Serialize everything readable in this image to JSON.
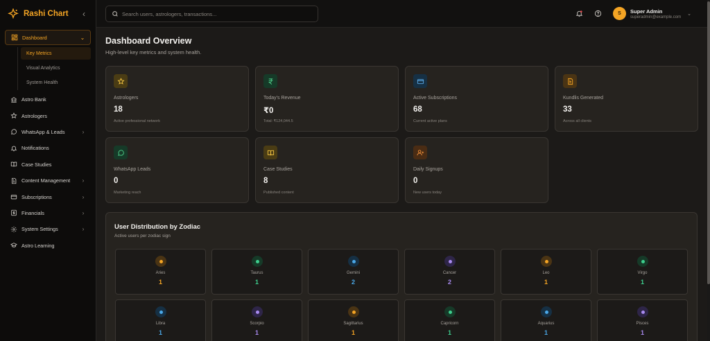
{
  "brand": {
    "name": "Rashi Chart"
  },
  "sidebar": {
    "dashboard": {
      "label": "Dashboard",
      "sub": [
        "Key Metrics",
        "Visual Analytics",
        "System Health"
      ]
    },
    "items": [
      {
        "label": "Astro Bank",
        "icon": "bank-icon",
        "chevron": false
      },
      {
        "label": "Astrologers",
        "icon": "star-icon",
        "chevron": false
      },
      {
        "label": "WhatsApp & Leads",
        "icon": "chat-icon",
        "chevron": true
      },
      {
        "label": "Notifications",
        "icon": "bell-icon",
        "chevron": false
      },
      {
        "label": "Case Studies",
        "icon": "book-icon",
        "chevron": false
      },
      {
        "label": "Content Management",
        "icon": "document-icon",
        "chevron": true
      },
      {
        "label": "Subscriptions",
        "icon": "card-icon",
        "chevron": true
      },
      {
        "label": "Financials",
        "icon": "dollar-icon",
        "chevron": true
      },
      {
        "label": "System Settings",
        "icon": "gear-icon",
        "chevron": true
      },
      {
        "label": "Astro Learning",
        "icon": "graduation-cap-icon",
        "chevron": false
      }
    ]
  },
  "topbar": {
    "search_placeholder": "Search users, astrologers, transactions...",
    "user": {
      "initial": "S",
      "name": "Super Admin",
      "email": "superadmin@example.com"
    }
  },
  "main": {
    "title": "Dashboard Overview",
    "subtitle": "High-level key metrics and system health.",
    "cards": [
      {
        "label": "Astrologers",
        "value": "18",
        "note": "Active professional network",
        "icon": "star-icon",
        "color": "#f5c542",
        "bg": "#4a3c14"
      },
      {
        "label": "Today's Revenue",
        "value": "₹0",
        "note": "Total: ₹124,044.5",
        "icon": "rupee-icon",
        "color": "#4fd08a",
        "bg": "#163a28"
      },
      {
        "label": "Active Subscriptions",
        "value": "68",
        "note": "Current active plans",
        "icon": "card-icon",
        "color": "#5aa9e6",
        "bg": "#163044"
      },
      {
        "label": "Kundlis Generated",
        "value": "33",
        "note": "Across all clients",
        "icon": "document-icon",
        "color": "#f5a524",
        "bg": "#4a3414"
      },
      {
        "label": "WhatsApp Leads",
        "value": "0",
        "note": "Marketing reach",
        "icon": "chat-icon",
        "color": "#4fd08a",
        "bg": "#163a28"
      },
      {
        "label": "Case Studies",
        "value": "8",
        "note": "Published content",
        "icon": "book-icon",
        "color": "#f5c542",
        "bg": "#4a3c14"
      },
      {
        "label": "Daily Signups",
        "value": "0",
        "note": "New users today",
        "icon": "user-plus-icon",
        "color": "#f0903a",
        "bg": "#4a2c14"
      }
    ],
    "zodiac": {
      "title": "User Distribution by Zodiac",
      "subtitle": "Active users per zodiac sign",
      "signs": [
        {
          "name": "Aries",
          "count": "1",
          "color": "#f5a524",
          "bg": "#4a3414"
        },
        {
          "name": "Taurus",
          "count": "1",
          "color": "#3ecf8e",
          "bg": "#163a28"
        },
        {
          "name": "Gemini",
          "count": "2",
          "color": "#4aa8e8",
          "bg": "#163044"
        },
        {
          "name": "Cancer",
          "count": "2",
          "color": "#a98bf0",
          "bg": "#2e2548"
        },
        {
          "name": "Leo",
          "count": "1",
          "color": "#f5a524",
          "bg": "#4a3414"
        },
        {
          "name": "Virgo",
          "count": "1",
          "color": "#3ecf8e",
          "bg": "#163a28"
        },
        {
          "name": "Libra",
          "count": "1",
          "color": "#4aa8e8",
          "bg": "#163044"
        },
        {
          "name": "Scorpio",
          "count": "1",
          "color": "#a98bf0",
          "bg": "#2e2548"
        },
        {
          "name": "Sagittarius",
          "count": "1",
          "color": "#f5a524",
          "bg": "#4a3414"
        },
        {
          "name": "Capricorn",
          "count": "1",
          "color": "#3ecf8e",
          "bg": "#163a28"
        },
        {
          "name": "Aquarius",
          "count": "1",
          "color": "#4aa8e8",
          "bg": "#163044"
        },
        {
          "name": "Pisces",
          "count": "1",
          "color": "#a98bf0",
          "bg": "#2e2548"
        }
      ]
    }
  }
}
